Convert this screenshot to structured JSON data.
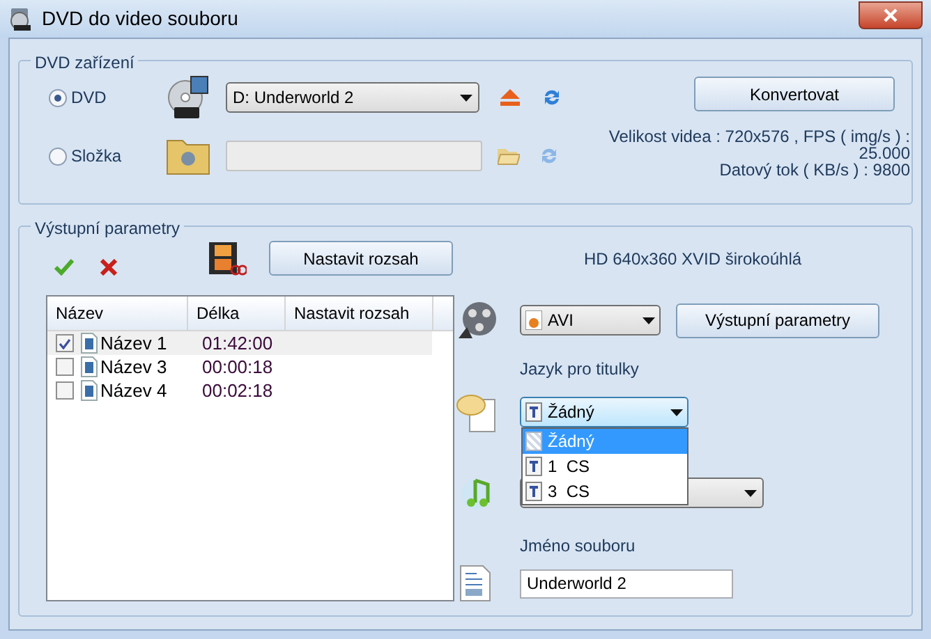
{
  "window": {
    "title": "DVD do video souboru"
  },
  "dvd_group": {
    "title": "DVD zařízení",
    "sources": [
      {
        "label": "DVD",
        "selected": true
      },
      {
        "label": "Složka",
        "selected": false
      }
    ],
    "drive_combo": {
      "value": "D:  Underworld 2"
    },
    "folder_field": {
      "disabled": true
    },
    "convert_button": "Konvertovat",
    "info_lines": [
      "Velikost videa : 720x576 , FPS ( img/s ) :",
      "25.000",
      "Datový tok ( KB/s ) : 9800"
    ]
  },
  "output_group": {
    "title": "Výstupní parametry",
    "range_button": "Nastavit rozsah",
    "list": {
      "columns": [
        "Název",
        "Délka",
        "Nastavit rozsah"
      ],
      "rows": [
        {
          "name": "Název 1",
          "duration": "01:42:00",
          "checked": true,
          "selected": true
        },
        {
          "name": "Název 3",
          "duration": "00:00:18",
          "checked": false,
          "selected": false
        },
        {
          "name": "Název 4",
          "duration": "00:02:18",
          "checked": false,
          "selected": false
        }
      ]
    },
    "profile": "HD 640x360 XVID širokoúhlá",
    "format_combo": {
      "value": "AVI"
    },
    "output_params_button": "Výstupní parametry",
    "subtitle_label": "Jazyk pro titulky",
    "subtitle_combo": {
      "value": "Žádný",
      "expanded": true,
      "options": [
        {
          "label": "Žádný",
          "selected": true
        },
        {
          "label": "1  CS",
          "selected": false
        },
        {
          "label": "3  CS",
          "selected": false
        }
      ]
    },
    "filename_label": "Jméno souboru",
    "filename": {
      "value": "Underworld 2"
    }
  }
}
